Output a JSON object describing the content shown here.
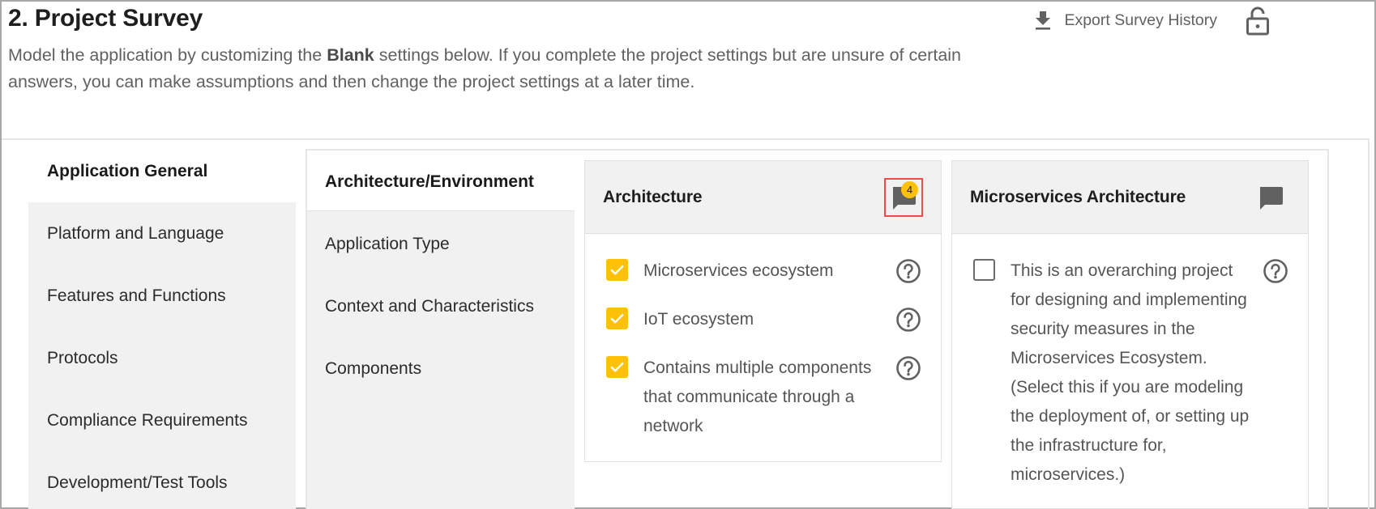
{
  "header": {
    "title": "2. Project Survey",
    "intro_before": "Model the application by customizing the ",
    "intro_bold": "Blank",
    "intro_after": " settings below. If you complete the project settings but are unsure of certain answers, you can make assumptions and then change the project settings at a later time.",
    "export_label": "Export Survey History",
    "export_icon": "download-icon",
    "lock_icon": "unlocked-padlock-icon"
  },
  "sidebar": {
    "items": [
      {
        "label": "Application General",
        "active": true
      },
      {
        "label": "Platform and Language",
        "active": false
      },
      {
        "label": "Features and Functions",
        "active": false
      },
      {
        "label": "Protocols",
        "active": false
      },
      {
        "label": "Compliance Requirements",
        "active": false
      },
      {
        "label": "Development/Test Tools",
        "active": false
      }
    ]
  },
  "subnav": {
    "items": [
      {
        "label": "Architecture/Environment",
        "active": true
      },
      {
        "label": "Application Type",
        "active": false
      },
      {
        "label": "Context and Characteristics",
        "active": false
      },
      {
        "label": "Components",
        "active": false
      }
    ]
  },
  "cards": [
    {
      "title": "Architecture",
      "comment_count": "4",
      "comment_highlighted": true,
      "options": [
        {
          "label": "Microservices ecosystem",
          "checked": true
        },
        {
          "label": "IoT ecosystem",
          "checked": true
        },
        {
          "label": "Contains multiple components that communicate through a network",
          "checked": true
        }
      ]
    },
    {
      "title": "Microservices Architecture",
      "comment_count": "",
      "comment_highlighted": false,
      "options": [
        {
          "label": "This is an overarching project for designing and implementing security measures in the Microservices Ecosystem. (Select this if you are modeling the deployment of, or setting up the infrastructure for, microservices.)",
          "checked": false
        }
      ]
    }
  ],
  "colors": {
    "accent_checkbox": "#ffc107",
    "badge": "#ffc107",
    "highlight_border": "#ef4b4b",
    "panel_gray": "#f1f1f1",
    "icon_gray": "#616161"
  }
}
